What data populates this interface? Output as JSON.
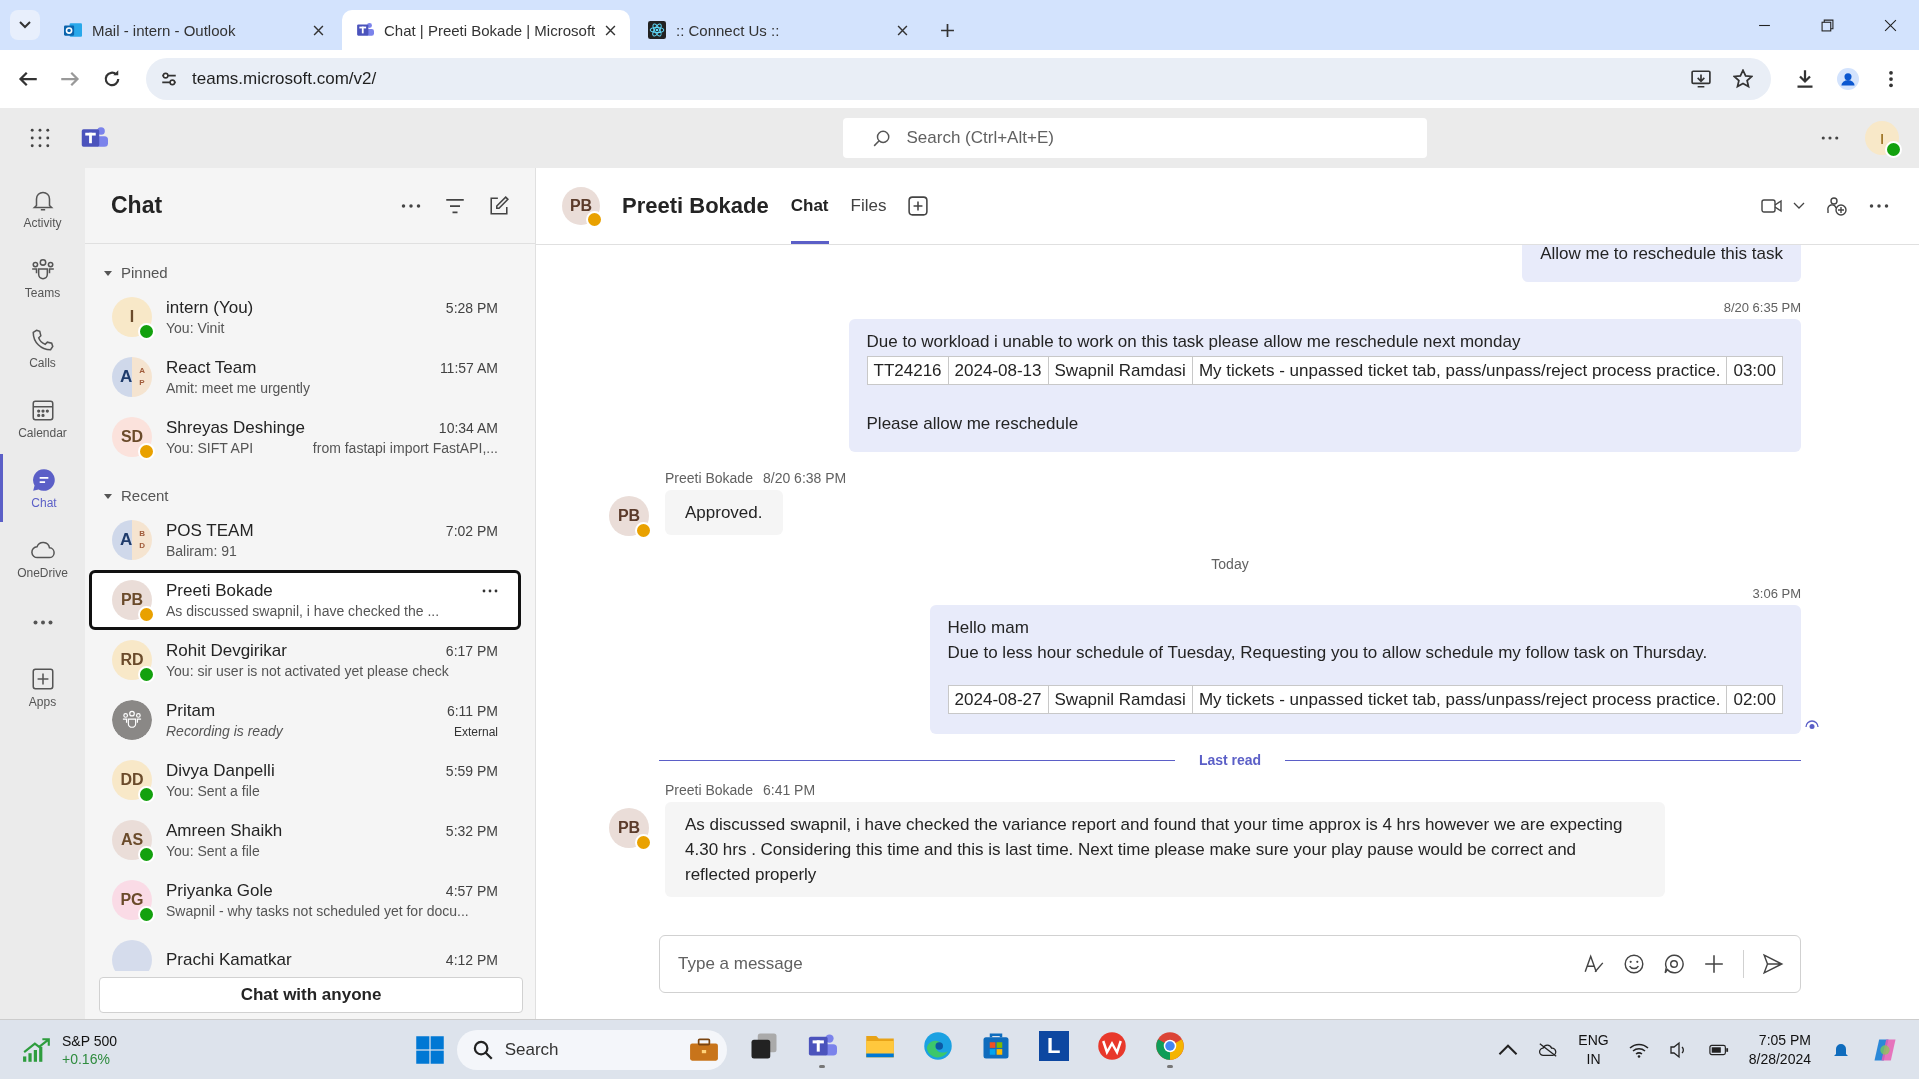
{
  "browser": {
    "tabs": [
      {
        "kind": "outlook",
        "title": "Mail - intern - Outlook",
        "selected": false
      },
      {
        "kind": "teams",
        "title": "Chat | Preeti Bokade | Microsoft",
        "selected": true
      },
      {
        "kind": "react",
        "title": ":: Connect Us ::",
        "selected": false
      }
    ],
    "url": "teams.microsoft.com/v2/"
  },
  "teams": {
    "search": {
      "placeholder": "Search (Ctrl+Alt+E)"
    },
    "user_initial": "I",
    "rail": [
      {
        "kind": "bell",
        "label": "Activity",
        "selected": false
      },
      {
        "kind": "teams",
        "label": "Teams",
        "selected": false
      },
      {
        "kind": "phone",
        "label": "Calls",
        "selected": false
      },
      {
        "kind": "calendar",
        "label": "Calendar",
        "selected": false
      },
      {
        "kind": "chat",
        "label": "Chat",
        "selected": true
      },
      {
        "kind": "cloud",
        "label": "OneDrive",
        "selected": false
      },
      {
        "kind": "more"
      },
      {
        "kind": "apps",
        "label": "Apps",
        "selected": false
      }
    ]
  },
  "chat_list": {
    "title": "Chat",
    "sections": [
      {
        "title": "Pinned",
        "expanded": true,
        "items": [
          {
            "kind": "person",
            "initials": "I",
            "color": "#f8e8c8",
            "name": "intern (You)",
            "preview": "You: Vinit",
            "time": "5:28 PM",
            "status": {
              "kind": "available"
            },
            "selected": false
          },
          {
            "kind": "group",
            "initials": "A",
            "sub": [
              "A",
              "P"
            ],
            "name": "React Team",
            "preview": "Amit: meet me urgently",
            "time": "11:57 AM",
            "selected": false
          },
          {
            "kind": "person",
            "initials": "SD",
            "color": "#fbe2dc",
            "name": "Shreyas Deshinge",
            "preview": "You: SIFT API",
            "preview_extra": "from fastapi import FastAPI,...",
            "time": "10:34 AM",
            "status": {
              "kind": "away"
            },
            "selected": false
          }
        ]
      },
      {
        "title": "Recent",
        "expanded": true,
        "items": [
          {
            "kind": "group",
            "initials": "A",
            "sub": [
              "B",
              "D"
            ],
            "name": "POS TEAM",
            "preview": "Baliram: 91",
            "time": "7:02 PM",
            "selected": false
          },
          {
            "kind": "person",
            "initials": "PB",
            "color": "#eaddd8",
            "name": "Preeti Bokade",
            "preview": "As discussed swapnil, i have checked the ...",
            "status": {
              "kind": "away"
            },
            "selected": true
          },
          {
            "kind": "person",
            "initials": "RD",
            "color": "#f8e8c8",
            "name": "Rohit Devgirikar",
            "preview": "You: sir user is not activated yet please check",
            "time": "6:17 PM",
            "status": {
              "kind": "available"
            },
            "selected": false
          },
          {
            "kind": "meeting",
            "name": "Pritam",
            "preview": "Recording is ready",
            "preview_italic": true,
            "time": "6:11 PM",
            "tag": "External",
            "selected": false
          },
          {
            "kind": "person",
            "initials": "DD",
            "color": "#f8e8c8",
            "name": "Divya Danpelli",
            "preview": "You: Sent a file",
            "time": "5:59 PM",
            "status": {
              "kind": "available"
            },
            "selected": false
          },
          {
            "kind": "person",
            "initials": "AS",
            "color": "#eaddd8",
            "name": "Amreen Shaikh",
            "preview": "You: Sent a file",
            "time": "5:32 PM",
            "status": {
              "kind": "available"
            },
            "selected": false
          },
          {
            "kind": "person",
            "initials": "PG",
            "color": "#fadbe6",
            "name": "Priyanka Gole",
            "preview": "Swapnil - why tasks not scheduled yet for docu...",
            "time": "4:57 PM",
            "status": {
              "kind": "available"
            },
            "selected": false
          },
          {
            "kind": "person",
            "color": "#d5dcec",
            "name": "Prachi Kamatkar",
            "time": "4:12 PM",
            "selected": false
          }
        ]
      }
    ],
    "button": "Chat with anyone"
  },
  "conversation": {
    "name": "Preeti Bokade",
    "initials": "PB",
    "status": {
      "kind": "away"
    },
    "tabs": [
      {
        "label": "Chat",
        "selected": true
      },
      {
        "label": "Files",
        "selected": false
      }
    ],
    "messages": [
      {
        "kind": "sent",
        "blocks": [
          {
            "kind": "text",
            "text": "Allow me to reschedule this task"
          }
        ]
      },
      {
        "kind": "sent",
        "time": "8/20 6:35 PM",
        "blocks": [
          {
            "kind": "text",
            "text": "Due to workload i unable to work on this task please allow me reschedule next monday"
          },
          {
            "kind": "table",
            "cells": [
              "TT24216",
              "2024-08-13",
              "Swapnil Ramdasi",
              "My tickets - unpassed ticket tab, pass/unpass/reject process practice.",
              "03:00"
            ]
          },
          {
            "kind": "text",
            "text": "Please allow me reschedule"
          }
        ]
      },
      {
        "kind": "received",
        "initials": "PB",
        "author": "Preeti Bokade",
        "time": "8/20 6:38 PM",
        "blocks": [
          {
            "kind": "text",
            "text": "Approved."
          }
        ]
      },
      {
        "kind": "day",
        "text": "Today"
      },
      {
        "kind": "sent",
        "time": "3:06 PM",
        "seen": true,
        "blocks": [
          {
            "kind": "text",
            "text": "Hello mam"
          },
          {
            "kind": "text",
            "text": "Due to less hour schedule of Tuesday, Requesting you to allow schedule my follow task on Thursday."
          },
          {
            "kind": "table",
            "cells": [
              "2024-08-27",
              "Swapnil Ramdasi",
              "My tickets - unpassed ticket tab, pass/unpass/reject process practice.",
              "02:00"
            ]
          }
        ]
      },
      {
        "kind": "last_read",
        "text": "Last read"
      },
      {
        "kind": "received",
        "initials": "PB",
        "author": "Preeti Bokade",
        "time": "6:41 PM",
        "blocks": [
          {
            "kind": "text",
            "text": "As discussed swapnil, i have checked the variance report and found that your time approx is 4 hrs however we are expecting 4.30 hrs . Considering this time and this is last time. Next time please make sure your play pause would be correct and reflected properly"
          }
        ]
      }
    ],
    "compose": {
      "placeholder": "Type a message"
    }
  },
  "taskbar": {
    "stock": {
      "name": "S&P 500",
      "change": "+0.16%"
    },
    "search": {
      "placeholder": "Search"
    },
    "apps": [
      {
        "kind": "taskview",
        "open": false
      },
      {
        "kind": "teams",
        "open": true
      },
      {
        "kind": "folder",
        "open": false
      },
      {
        "kind": "edge",
        "open": false
      },
      {
        "kind": "store",
        "open": false
      },
      {
        "kind": "letter",
        "label": "L",
        "open": false
      },
      {
        "kind": "wps",
        "open": false
      },
      {
        "kind": "chrome",
        "open": true
      }
    ],
    "language": "ENG",
    "region": "IN",
    "time": "7:05 PM",
    "date": "8/28/2024"
  }
}
